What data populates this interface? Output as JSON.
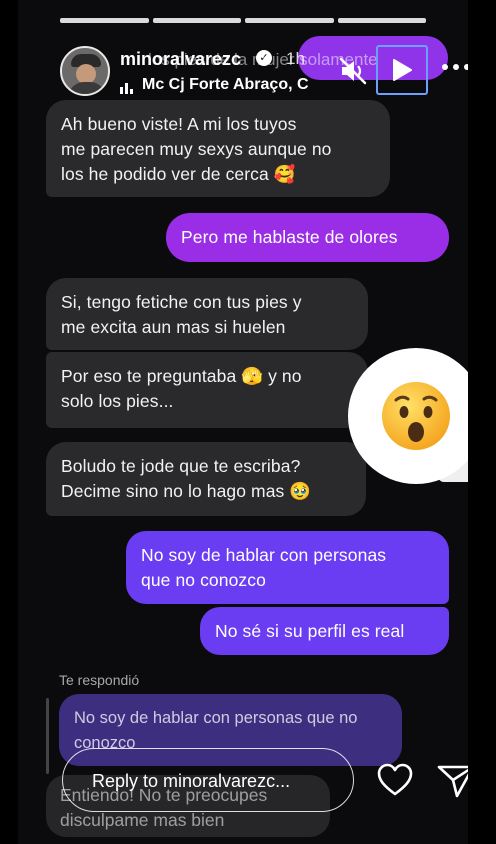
{
  "story": {
    "progress_segments": 4,
    "username": "minoralvarezc",
    "verified_mark": "✓",
    "time_ago": "1h",
    "music": "Mc Cj Forte Abraço, C",
    "overlay_text": "los pies de la mujer solamente",
    "icons": {
      "mute": "speaker-muted-icon",
      "play": "play-icon",
      "more": "more-icon"
    }
  },
  "messages": [
    {
      "side": "left",
      "text": "Ah bueno viste! A mi los tuyos\nme parecen muy sexys aunque no\nlos he podido ver de cerca 🥰"
    },
    {
      "side": "right",
      "text": "Pero me hablaste de olores"
    },
    {
      "side": "left",
      "text": "Si, tengo fetiche con tus pies y\nme excita aun mas si huelen"
    },
    {
      "side": "left",
      "text": "Por eso te preguntaba 🫣 y no\nsolo los pies..."
    },
    {
      "side": "left",
      "text": "Boludo te jode que te escriba?\nDecime sino no lo hago mas 🥹"
    },
    {
      "side": "right",
      "text": "No soy de hablar con personas\nque no conozco"
    },
    {
      "side": "right",
      "text": "No sé si su perfil es real"
    }
  ],
  "reaction": {
    "emoji": "😮"
  },
  "reply_thread": {
    "label": "Te respondió",
    "quoted": "No soy de hablar con personas que no\nconozco",
    "last_message": "Entiendo! No te preocupes\ndisculpame mas bien"
  },
  "footer": {
    "reply_placeholder": "Reply to minoralvarezc...",
    "icons": {
      "like": "heart-icon",
      "send": "send-icon"
    }
  },
  "colors": {
    "background": "#0b0b0d",
    "incoming": "#2a2a2d",
    "outgoing_purple": "#9a2ee6",
    "outgoing_violet": "#6a3cf2",
    "quoted": "#3e2e80"
  }
}
